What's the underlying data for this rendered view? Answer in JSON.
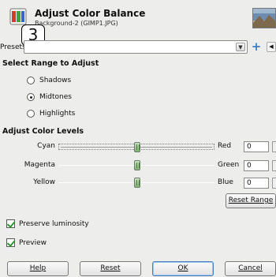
{
  "header": {
    "title": "Adjust Color Balance",
    "subtitle": "Background-2 (GIMP1.JPG)",
    "step_badge": "3"
  },
  "presets": {
    "label": "Presets:",
    "value": "",
    "add_icon": "plus-icon",
    "menu_icon": "arrow-left-icon"
  },
  "range": {
    "heading": "Select Range to Adjust",
    "options": [
      {
        "label": "Shadows",
        "selected": false
      },
      {
        "label": "Midtones",
        "selected": true
      },
      {
        "label": "Highlights",
        "selected": false
      }
    ]
  },
  "levels": {
    "heading": "Adjust Color Levels",
    "rows": [
      {
        "left": "Cyan",
        "right": "Red",
        "value": "0",
        "position": 0
      },
      {
        "left": "Magenta",
        "right": "Green",
        "value": "0",
        "position": 0
      },
      {
        "left": "Yellow",
        "right": "Blue",
        "value": "0",
        "position": 0
      }
    ],
    "reset_range": "Reset Range"
  },
  "options": {
    "preserve_luminosity": {
      "label": "Preserve luminosity",
      "checked": true
    },
    "preview": {
      "label": "Preview",
      "checked": true
    }
  },
  "buttons": {
    "help": "Help",
    "reset": "Reset",
    "ok": "OK",
    "cancel": "Cancel"
  }
}
